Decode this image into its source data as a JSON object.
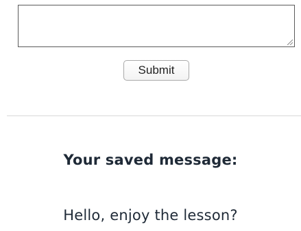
{
  "form": {
    "message_value": "",
    "submit_label": "Submit"
  },
  "saved": {
    "heading": "Your saved message:",
    "message": "Hello, enjoy the lesson?"
  }
}
